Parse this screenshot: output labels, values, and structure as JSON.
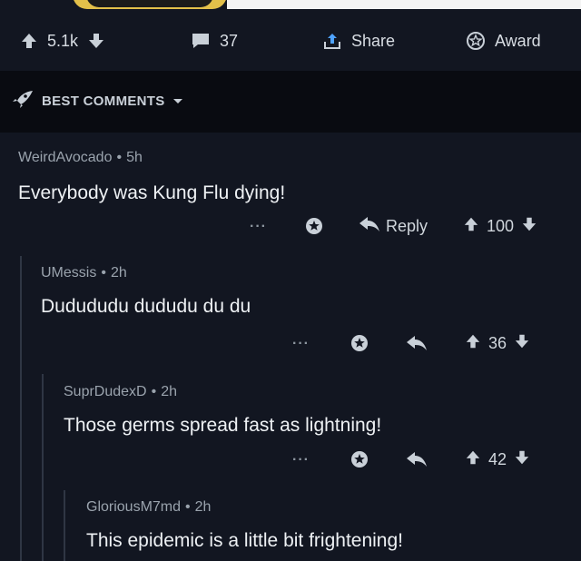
{
  "post_actions": {
    "upvotes": "5.1k",
    "comments": "37",
    "share_label": "Share",
    "award_label": "Award"
  },
  "sort": {
    "label": "BEST COMMENTS"
  },
  "comments": [
    {
      "author": "WeirdAvocado",
      "age": "5h",
      "text": "Everybody was Kung Flu dying!",
      "reply_label": "Reply",
      "score": "100"
    },
    {
      "author": "UMessis",
      "age": "2h",
      "text": "Dudududu dududu du du",
      "score": "36"
    },
    {
      "author": "SuprDudexD",
      "age": "2h",
      "text": "Those germs spread fast as lightning!",
      "score": "42"
    },
    {
      "author": "GloriousM7md",
      "age": "2h",
      "text": "This epidemic is a little bit frightening!"
    }
  ],
  "colors": {
    "background": "#121621",
    "sortbar": "#090b11",
    "thread_line": "#2f3644",
    "meta_text": "#9aa3ad"
  }
}
